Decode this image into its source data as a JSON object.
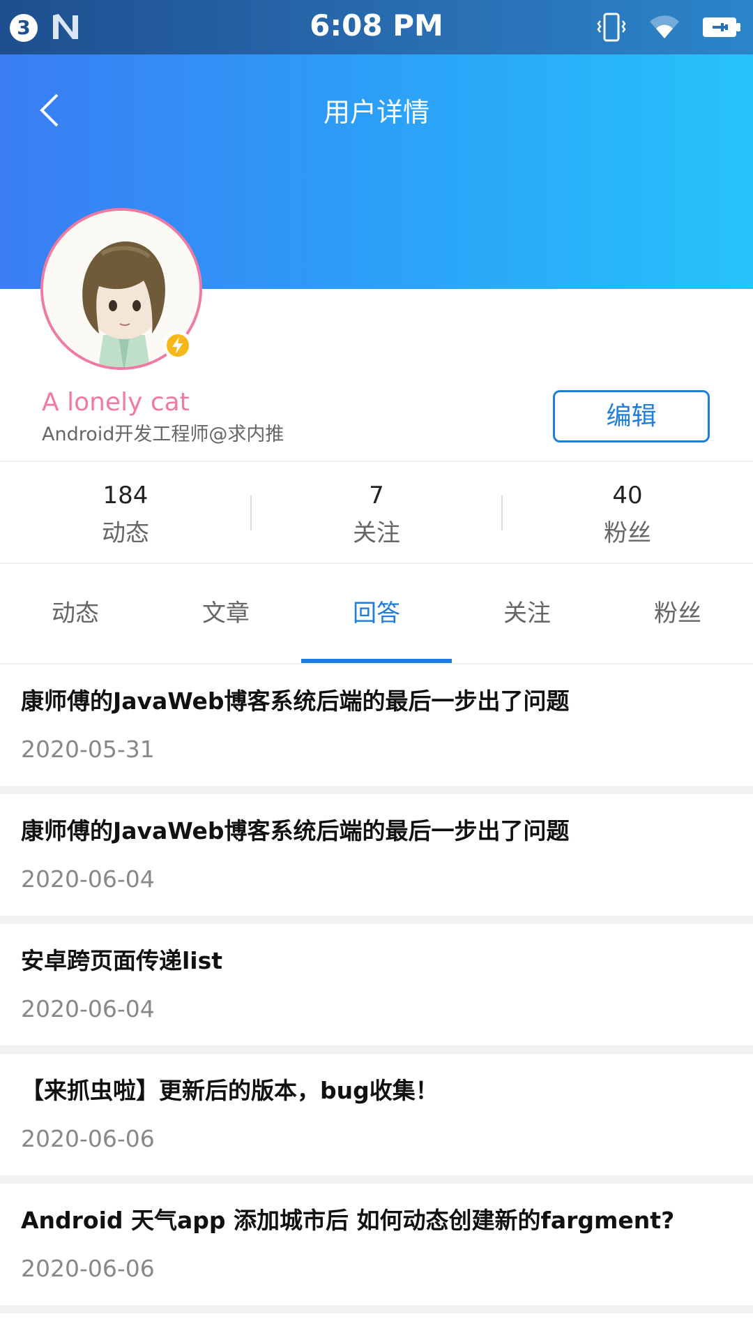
{
  "status_bar": {
    "badge": "3",
    "time": "6:08 PM"
  },
  "nav": {
    "title": "用户详情"
  },
  "profile": {
    "name": "A lonely cat",
    "title": "Android开发工程师@求内推",
    "edit_label": "编辑"
  },
  "stats": [
    {
      "value": "184",
      "label": "动态"
    },
    {
      "value": "7",
      "label": "关注"
    },
    {
      "value": "40",
      "label": "粉丝"
    }
  ],
  "tabs": [
    {
      "label": "动态"
    },
    {
      "label": "文章"
    },
    {
      "label": "回答"
    },
    {
      "label": "关注"
    },
    {
      "label": "粉丝"
    }
  ],
  "active_tab": "回答",
  "posts": [
    {
      "title": "康师傅的JavaWeb博客系统后端的最后一步出了问题",
      "date": "2020-05-31"
    },
    {
      "title": "康师傅的JavaWeb博客系统后端的最后一步出了问题",
      "date": "2020-06-04"
    },
    {
      "title": "安卓跨页面传递list",
      "date": "2020-06-04"
    },
    {
      "title": "【来抓虫啦】更新后的版本，bug收集！",
      "date": "2020-06-06"
    },
    {
      "title": "Android 天气app 添加城市后 如何动态创建新的fargment?",
      "date": "2020-06-06"
    }
  ],
  "colors": {
    "accent": "#1e7de0",
    "name_pink": "#f07aa0",
    "badge_yellow": "#f6b719"
  }
}
